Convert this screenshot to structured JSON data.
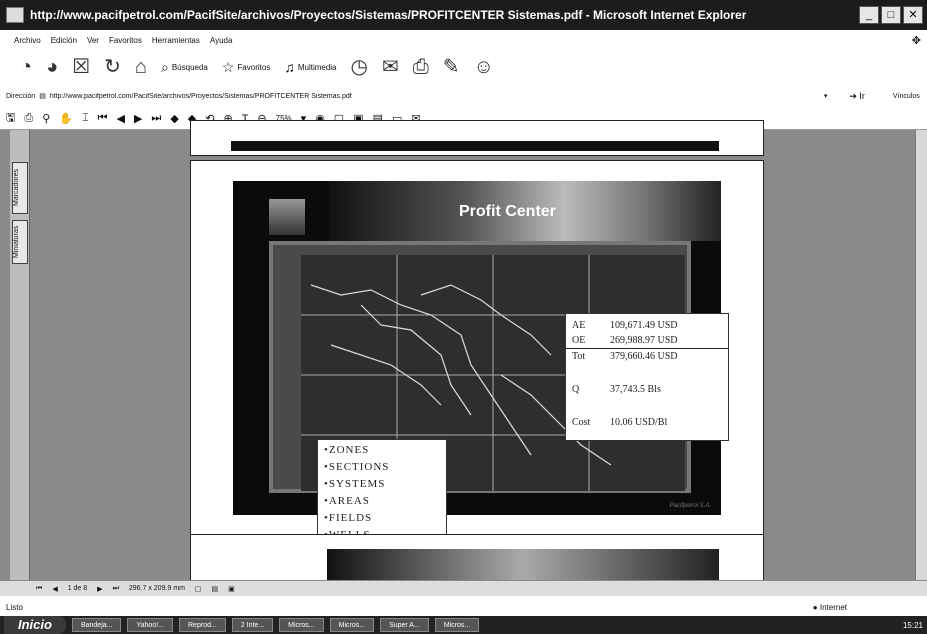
{
  "window": {
    "title": "http://www.pacifpetrol.com/PacifSite/archivos/Proyectos/Sistemas/PROFITCENTER Sistemas.pdf - Microsoft Internet Explorer"
  },
  "menu": [
    "Archivo",
    "Edición",
    "Ver",
    "Favoritos",
    "Herramientas",
    "Ayuda"
  ],
  "nav": {
    "search_label": "Búsqueda",
    "favorites_label": "Favoritos",
    "media_label": "Multimedia"
  },
  "address": {
    "label": "Dirección",
    "url": "http://www.pacifpetrol.com/PacifSite/archivos/Proyectos/Sistemas/PROFITCENTER Sistemas.pdf",
    "go": "Ir",
    "links": "Vínculos"
  },
  "pdf": {
    "zoom": "75%"
  },
  "side_tabs": [
    "Marcadores",
    "Miniaturas"
  ],
  "slide": {
    "title": "Profit Center",
    "values": [
      {
        "k": "AE",
        "v": "109,671.49 USD"
      },
      {
        "k": "OE",
        "v": "269,988.97 USD"
      },
      {
        "k": "Tot",
        "v": "379,660.46 USD"
      },
      {
        "k": "Q",
        "v": "37,743.5 Bls"
      },
      {
        "k": "Cost",
        "v": "10.06 USD/Bl"
      }
    ],
    "list": [
      "•ZONES",
      "•SECTIONS",
      "•SYSTEMS",
      "•AREAS",
      "•FIELDS",
      "•WELLS"
    ],
    "footer": "Pacifpetrol S.A."
  },
  "pagenav": {
    "page": "1 de 8",
    "size": "296.7 x 209.9 mm"
  },
  "status": {
    "left": "Listo",
    "zone": "Internet"
  },
  "taskbar": {
    "start": "Inicio",
    "items": [
      "Bandeja...",
      "Yahoo!...",
      "Reprod...",
      "2 Inte...",
      "Micros...",
      "Micros...",
      "Super A...",
      "Micros..."
    ],
    "clock": "15:21"
  }
}
